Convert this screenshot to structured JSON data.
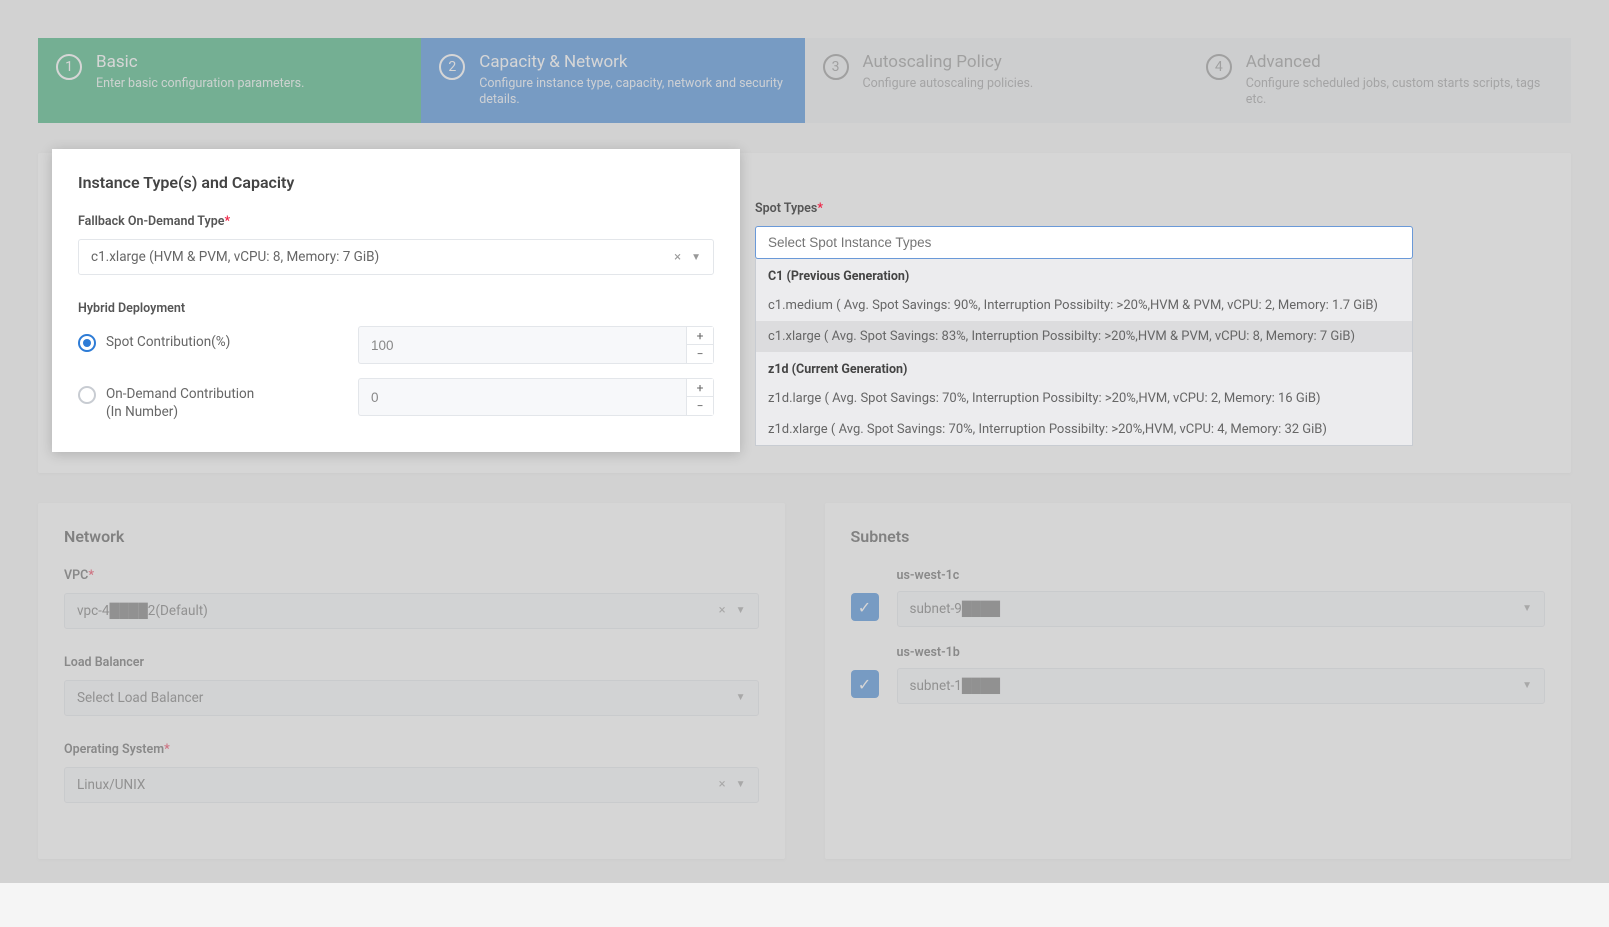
{
  "steps": [
    {
      "num": "1",
      "title": "Basic",
      "desc": "Enter basic configuration parameters."
    },
    {
      "num": "2",
      "title": "Capacity & Network",
      "desc": "Configure instance type, capacity, network and security details."
    },
    {
      "num": "3",
      "title": "Autoscaling Policy",
      "desc": "Configure autoscaling policies."
    },
    {
      "num": "4",
      "title": "Advanced",
      "desc": "Configure scheduled jobs, custom starts scripts, tags etc."
    }
  ],
  "instance": {
    "section_title": "Instance Type(s) and Capacity",
    "fallback_label": "Fallback On-Demand Type",
    "fallback_value": "c1.xlarge (HVM & PVM, vCPU: 8, Memory: 7 GiB)",
    "hybrid_label": "Hybrid Deployment",
    "spot_radio_label": "Spot Contribution(%)",
    "spot_value": "100",
    "ondemand_radio_label": "On-Demand Contribution\n(In Number)",
    "ondemand_value": "0"
  },
  "spot": {
    "label": "Spot Types",
    "placeholder": "Select Spot Instance Types",
    "group1": "C1 (Previous Generation)",
    "opt1": "c1.medium ( Avg. Spot Savings: 90%, Interruption Possibilty: >20%,HVM & PVM, vCPU: 2, Memory: 1.7 GiB)",
    "opt2": "c1.xlarge ( Avg. Spot Savings: 83%, Interruption Possibilty: >20%,HVM & PVM, vCPU: 8, Memory: 7 GiB)",
    "group2": "z1d (Current Generation)",
    "opt3": "z1d.large ( Avg. Spot Savings: 70%, Interruption Possibilty: >20%,HVM, vCPU: 2, Memory: 16 GiB)",
    "opt4": "z1d.xlarge ( Avg. Spot Savings: 70%, Interruption Possibilty: >20%,HVM, vCPU: 4, Memory: 32 GiB)"
  },
  "network": {
    "section_title": "Network",
    "vpc_label": "VPC",
    "vpc_value": "vpc-4████2(Default)",
    "lb_label": "Load Balancer",
    "lb_placeholder": "Select Load Balancer",
    "os_label": "Operating System",
    "os_value": "Linux/UNIX"
  },
  "subnets": {
    "section_title": "Subnets",
    "r1_region": "us-west-1c",
    "r1_value": "subnet-9████",
    "r2_region": "us-west-1b",
    "r2_value": "subnet-1████"
  }
}
